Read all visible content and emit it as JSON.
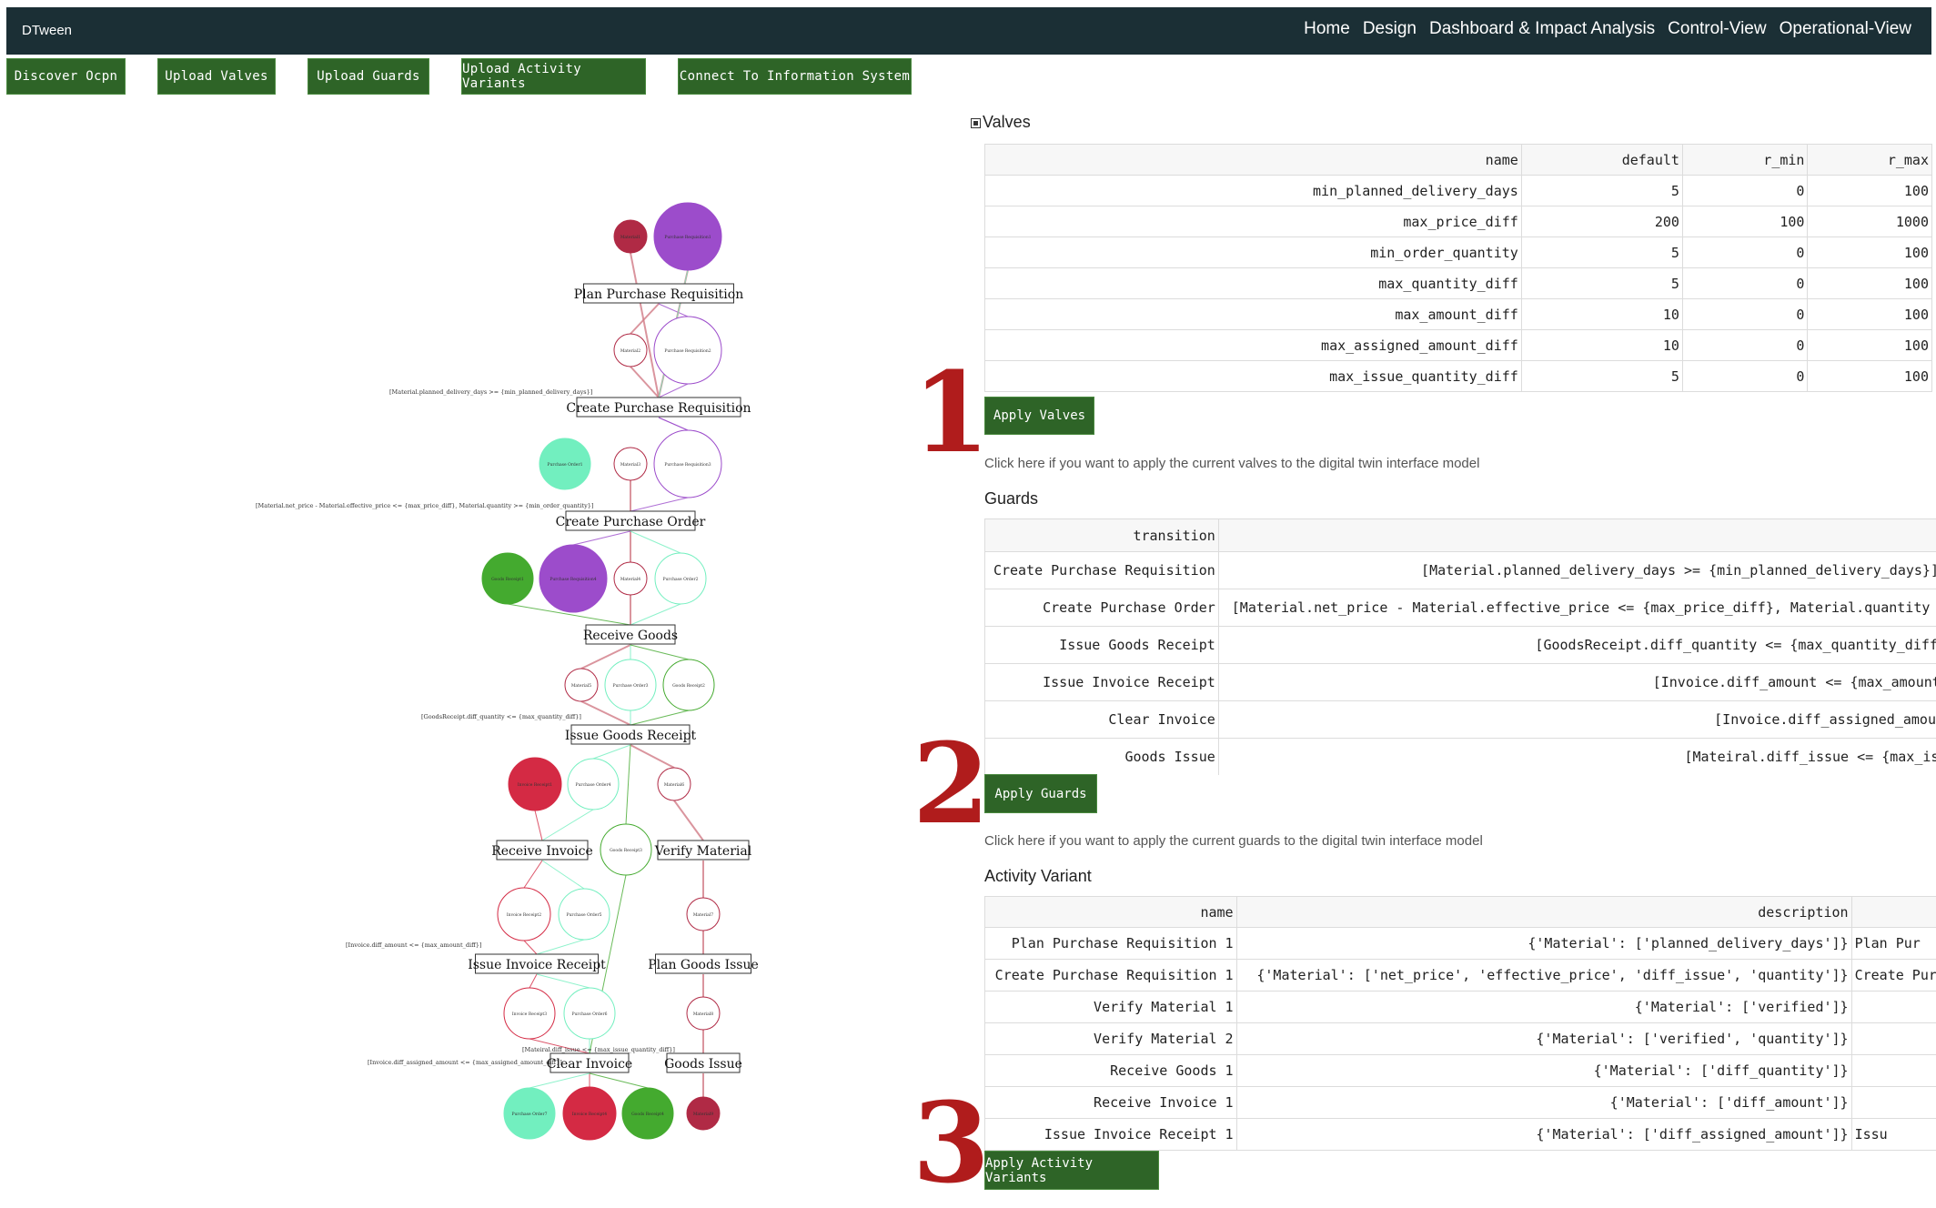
{
  "app": {
    "brand": "DTween"
  },
  "nav": {
    "items": [
      "Home",
      "Design",
      "Dashboard & Impact Analysis",
      "Control-View",
      "Operational-View"
    ]
  },
  "toolbar": {
    "discover": "Discover Ocpn",
    "upload_valves": "Upload Valves",
    "upload_guards": "Upload Guards",
    "upload_variants": "Upload Activity Variants",
    "connect": "Connect To Information System"
  },
  "steps": [
    "1",
    "2",
    "3"
  ],
  "valves": {
    "title": "Valves",
    "columns": [
      "name",
      "default",
      "r_min",
      "r_max"
    ],
    "rows": [
      [
        "min_planned_delivery_days",
        "5",
        "0",
        "100"
      ],
      [
        "max_price_diff",
        "200",
        "100",
        "1000"
      ],
      [
        "min_order_quantity",
        "5",
        "0",
        "100"
      ],
      [
        "max_quantity_diff",
        "5",
        "0",
        "100"
      ],
      [
        "max_amount_diff",
        "10",
        "0",
        "100"
      ],
      [
        "max_assigned_amount_diff",
        "10",
        "0",
        "100"
      ],
      [
        "max_issue_quantity_diff",
        "5",
        "0",
        "100"
      ]
    ],
    "apply_label": "Apply Valves",
    "hint": "Click here if you want to apply the current valves to the digital twin interface model"
  },
  "guards": {
    "title": "Guards",
    "columns": [
      "transition",
      ""
    ],
    "rows": [
      [
        "Create Purchase Requisition",
        "[Material.planned_delivery_days >= {min_planned_delivery_days}]"
      ],
      [
        "Create Purchase Order",
        "[Material.net_price - Material.effective_price <= {max_price_diff}, Material.quantity >= {min_order_quantity}]"
      ],
      [
        "Issue Goods Receipt",
        "[GoodsReceipt.diff_quantity <= {max_quantity_diff}]"
      ],
      [
        "Issue Invoice Receipt",
        "[Invoice.diff_amount <= {max_amount_diff}]"
      ],
      [
        "Clear Invoice",
        "[Invoice.diff_assigned_amount <= {max_assigned_amount_diff}]"
      ],
      [
        "Goods Issue",
        "[Mateiral.diff_issue <= {max_issue_quantity_diff}]"
      ]
    ],
    "apply_label": "Apply Guards",
    "hint": "Click here if you want to apply the current guards to the digital twin interface model"
  },
  "variants": {
    "title": "Activity Variant",
    "columns": [
      "name",
      "description",
      ""
    ],
    "rows": [
      [
        "Plan Purchase Requisition 1",
        "{'Material': ['planned_delivery_days']}",
        "Plan Pur"
      ],
      [
        "Create Purchase Requisition 1",
        "{'Material': ['net_price', 'effective_price', 'diff_issue', 'quantity']}",
        "Create Pur"
      ],
      [
        "Verify Material 1",
        "{'Material': ['verified']}",
        ""
      ],
      [
        "Verify Material 2",
        "{'Material': ['verified', 'quantity']}",
        ""
      ],
      [
        "Receive Goods 1",
        "{'Material': ['diff_quantity']}",
        ""
      ],
      [
        "Receive Invoice 1",
        "{'Material': ['diff_amount']}",
        ""
      ],
      [
        "Issue Invoice Receipt 1",
        "{'Material': ['diff_assigned_amount']}",
        "Issu"
      ]
    ],
    "apply_label": "Apply Activity Variants"
  },
  "petri_net": {
    "transitions": [
      "Plan Purchase Requisition",
      "Create Purchase Requisition",
      "Create Purchase Order",
      "Receive Goods",
      "Issue Goods Receipt",
      "Receive Invoice",
      "Verify Material",
      "Issue Invoice Receipt",
      "Plan Goods Issue",
      "Clear Invoice",
      "Goods Issue"
    ],
    "places": [
      "Material1",
      "Purchase Requisition1",
      "Material2",
      "Purchase Requisition2",
      "Purchase Order1",
      "Material3",
      "Purchase Requisition3",
      "Goods Receipt1",
      "Purchase Requisition4",
      "Material4",
      "Purchase Order2",
      "Material5",
      "Purchase Order3",
      "Goods Receipt2",
      "Invoice Receipt1",
      "Purchase Order4",
      "Material6",
      "Goods Receipt3",
      "Invoice Receipt2",
      "Purchase Order5",
      "Material7",
      "Invoice Receipt3",
      "Purchase Order6",
      "Material8",
      "Purchase Order7",
      "Invoice Receipt4",
      "Goods Receipt4",
      "Material9"
    ],
    "guard_labels": [
      "[Material.planned_delivery_days >= {min_planned_delivery_days}]",
      "[Material.net_price - Material.effective_price <= {max_price_diff}, Material.quantity >= {min_order_quantity}]",
      "[GoodsReceipt.diff_quantity <= {max_quantity_diff}]",
      "[Invoice.diff_amount <= {max_amount_diff}]",
      "[Mateiral.diff_issue <= {max_issue_quantity_diff}]",
      "[Invoice.diff_assigned_amount <= {max_assigned_amount_diff}]"
    ],
    "colors": {
      "material": "#b02a45",
      "requisition": "#9c4ccb",
      "order": "#72efbf",
      "receipt": "#44aa2f",
      "invoice": "#d42a44"
    }
  }
}
